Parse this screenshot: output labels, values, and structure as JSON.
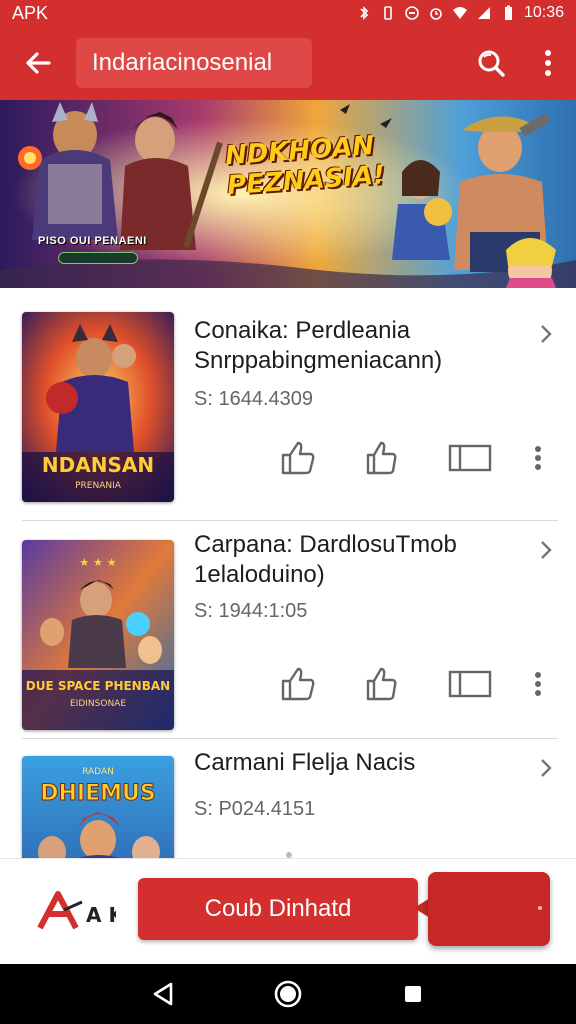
{
  "status_bar": {
    "left_text": "APK",
    "time": "10:36"
  },
  "app_bar": {
    "title": "Indariacinosenial"
  },
  "banner": {
    "title": "NDKHOAN PEZNASIA!",
    "caption": "PISO OUI PENAENI"
  },
  "items": [
    {
      "title": "Conaika: Perdleania Snrppabingmeniacann)",
      "size": "S: 1644.4309",
      "thumb_text": "NDANSAN",
      "thumb_sub": "PRENANIA"
    },
    {
      "title": "Carpana: DardlosuTmob 1elaloduino)",
      "size": "S: 1944:1:05",
      "thumb_text": "DUE SPACE PHENBAN",
      "thumb_sub": "EIDINSONAE"
    },
    {
      "title": "Carmani Flelja Nacis",
      "size": "S: P024.4151",
      "thumb_text": "DHIEMUS",
      "thumb_sub": "RADAN"
    }
  ],
  "bottom": {
    "logo_text": "A K",
    "cta_label": "Coub Dinhatd"
  },
  "colors": {
    "primary": "#d32f2f",
    "primary_dark": "#c62828"
  },
  "icons": {
    "back": "arrow-back-icon",
    "search": "search-icon",
    "more": "more-vert-icon",
    "chevron": "chevron-right-icon",
    "like": "thumb-up-icon",
    "card": "card-icon",
    "nav_back": "triangle-back-icon",
    "nav_home": "circle-home-icon",
    "nav_recent": "square-recent-icon"
  }
}
